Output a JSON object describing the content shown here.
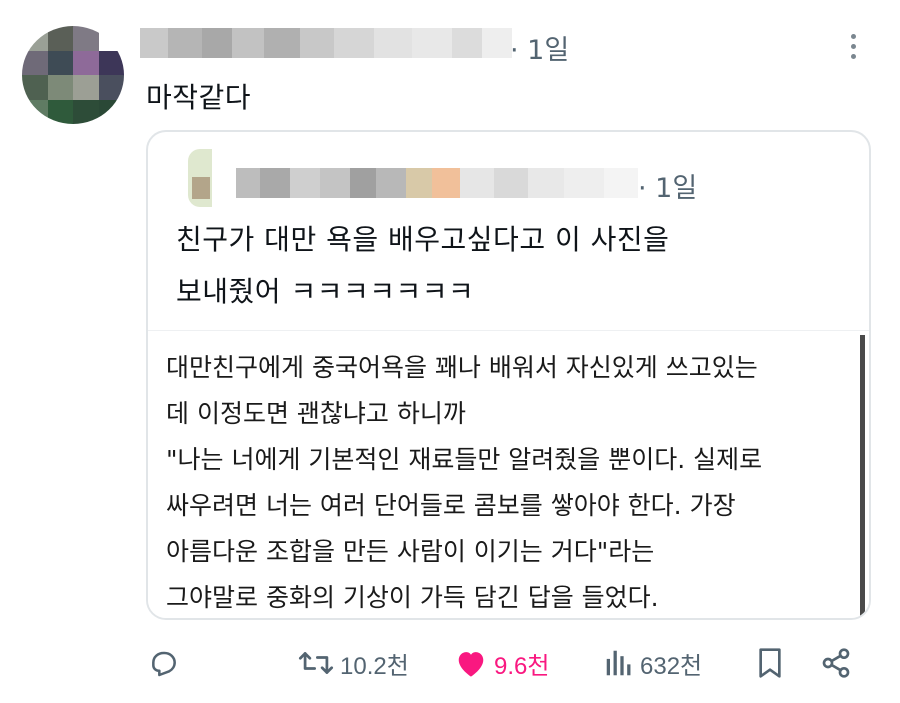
{
  "post": {
    "time": "· 1일",
    "text": "마작같다",
    "more_icon": "more-vertical-icon"
  },
  "quoted": {
    "time": "· 1일",
    "text_lines": [
      "친구가 대만 욕을 배우고싶다고 이 사진을",
      "보내줬어 ㅋㅋㅋㅋㅋㅋㅋ"
    ],
    "image_text_lines": [
      "대만친구에게 중국어욕을 꽤나 배워서 자신있게 쓰고있는",
      "데 이정도면 괜찮냐고 하니까",
      "\"나는 너에게 기본적인 재료들만 알려줬을 뿐이다. 실제로",
      "싸우려면 너는 여러 단어들로 콤보를 쌓아야 한다. 가장",
      "아름다운 조합을 만든 사람이 이기는 거다\"라는",
      "그야말로 중화의 기상이 가득 담긴 답을 들었다."
    ]
  },
  "actions": {
    "reply_icon": "reply-icon",
    "retweet_count": "10.2천",
    "like_count": "9.6천",
    "like_color": "#f91880",
    "views_count": "632천",
    "bookmark_icon": "bookmark-icon",
    "share_icon": "share-icon"
  }
}
